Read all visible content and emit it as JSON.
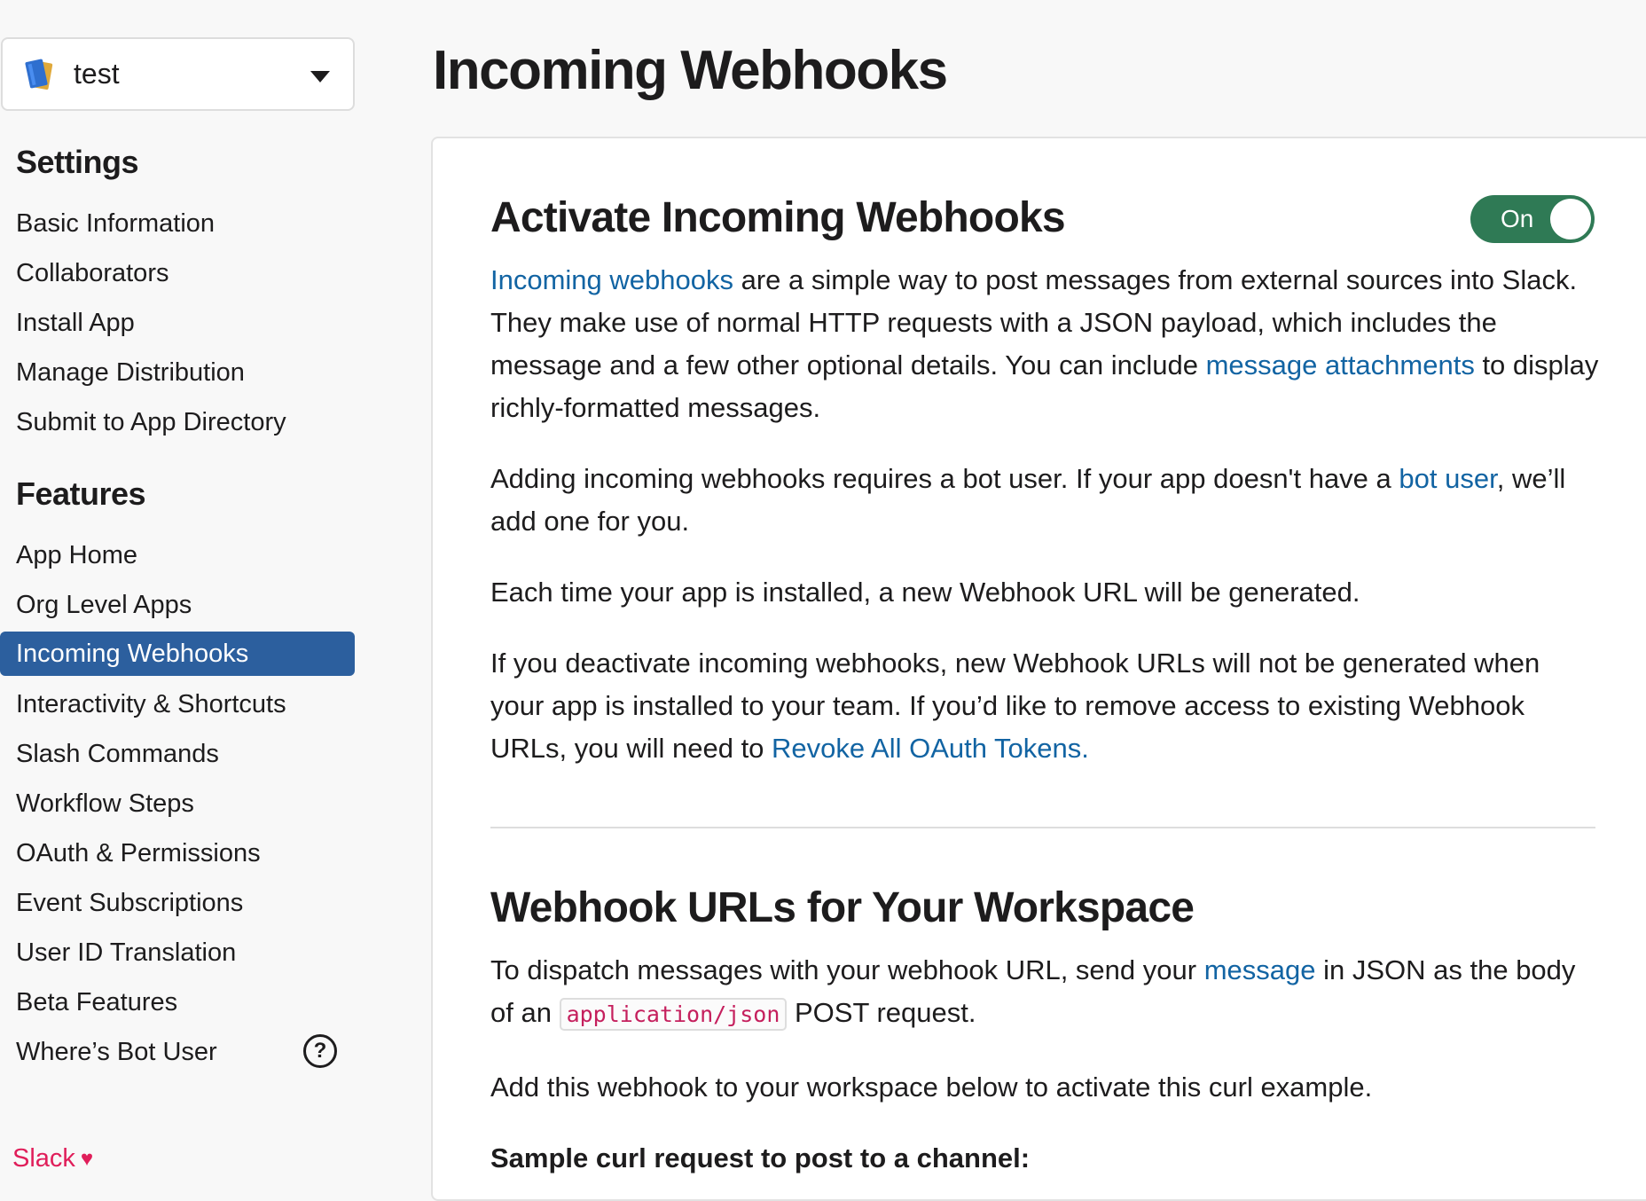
{
  "app_selector": {
    "name": "test"
  },
  "sidebar": {
    "settings_title": "Settings",
    "settings_items": [
      "Basic Information",
      "Collaborators",
      "Install App",
      "Manage Distribution",
      "Submit to App Directory"
    ],
    "features_title": "Features",
    "features_items": [
      "App Home",
      "Org Level Apps",
      "Incoming Webhooks",
      "Interactivity & Shortcuts",
      "Slash Commands",
      "Workflow Steps",
      "OAuth & Permissions",
      "Event Subscriptions",
      "User ID Translation",
      "Beta Features",
      "Where’s Bot User"
    ],
    "active_item": "Incoming Webhooks",
    "help_glyph": "?",
    "footer": "Slack",
    "footer_icon": "heart-icon"
  },
  "page": {
    "title": "Incoming Webhooks"
  },
  "activate": {
    "heading": "Activate Incoming Webhooks",
    "toggle_label": "On",
    "toggle_state": "on",
    "p1": {
      "link1": "Incoming webhooks",
      "text1": " are a simple way to post messages from external sources into Slack. They make use of normal HTTP requests with a JSON payload, which includes the message and a few other optional details. You can include ",
      "link2": "message attachments",
      "text2": " to display richly-formatted messages."
    },
    "p2": {
      "text1": "Adding incoming webhooks requires a bot user. If your app doesn't have a ",
      "link": "bot user",
      "text2": ", we’ll add one for you."
    },
    "p3": "Each time your app is installed, a new Webhook URL will be generated.",
    "p4": {
      "text1": "If you deactivate incoming webhooks, new Webhook URLs will not be generated when your app is installed to your team. If you’d like to remove access to existing Webhook URLs, you will need to ",
      "link": "Revoke All OAuth Tokens."
    }
  },
  "webhook_urls": {
    "heading": "Webhook URLs for Your Workspace",
    "p1": {
      "text1": "To dispatch messages with your webhook URL, send your ",
      "link": "message",
      "text2": " in JSON as the body of an ",
      "code": "application/json",
      "text3": " POST request."
    },
    "p2": "Add this webhook to your workspace below to activate this curl example.",
    "sample_label": "Sample curl request to post to a channel:"
  },
  "colors": {
    "active_nav": "#2c5f9e",
    "toggle_on": "#2f7a55",
    "link": "#1264a3",
    "code": "#c51f5d",
    "brand": "#e01e5a"
  }
}
